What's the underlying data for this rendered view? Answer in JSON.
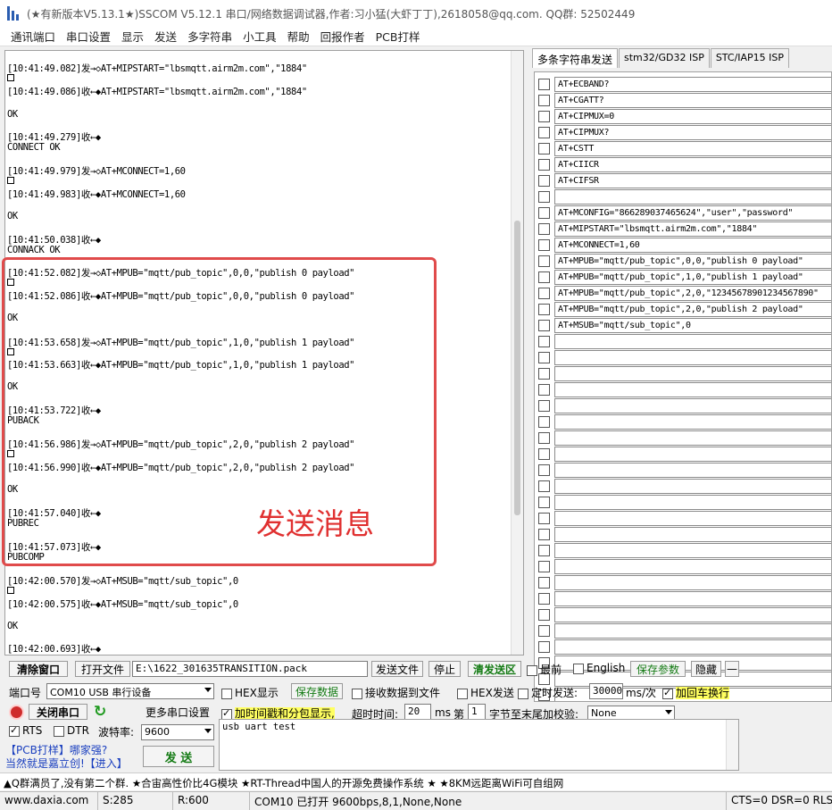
{
  "window": {
    "title": "(★有新版本V5.13.1★)SSCOM V5.12.1 串口/网络数据调试器,作者:习小猛(大虾丁丁),2618058@qq.com. QQ群:  52502449"
  },
  "menu": [
    "通讯端口",
    "串口设置",
    "显示",
    "发送",
    "多字符串",
    "小工具",
    "帮助",
    "回报作者",
    "PCB打样"
  ],
  "log": {
    "lines": [
      "[10:41:49.082]发→◇AT+MIPSTART=\"lbsmqtt.airm2m.com\",\"1884\"",
      "[10:41:49.086]收←◆AT+MIPSTART=\"lbsmqtt.airm2m.com\",\"1884\"",
      "OK",
      "[10:41:49.279]收←◆",
      "CONNECT OK",
      "[10:41:49.979]发→◇AT+MCONNECT=1,60",
      "[10:41:49.983]收←◆AT+MCONNECT=1,60",
      "OK",
      "[10:41:50.038]收←◆",
      "CONNACK OK",
      "[10:41:52.082]发→◇AT+MPUB=\"mqtt/pub_topic\",0,0,\"publish 0 payload\"",
      "[10:41:52.086]收←◆AT+MPUB=\"mqtt/pub_topic\",0,0,\"publish 0 payload\"",
      "OK",
      "[10:41:53.658]发→◇AT+MPUB=\"mqtt/pub_topic\",1,0,\"publish 1 payload\"",
      "[10:41:53.663]收←◆AT+MPUB=\"mqtt/pub_topic\",1,0,\"publish 1 payload\"",
      "OK",
      "[10:41:53.722]收←◆",
      "PUBACK",
      "[10:41:56.986]发→◇AT+MPUB=\"mqtt/pub_topic\",2,0,\"publish 2 payload\"",
      "[10:41:56.990]收←◆AT+MPUB=\"mqtt/pub_topic\",2,0,\"publish 2 payload\"",
      "OK",
      "[10:41:57.040]收←◆",
      "PUBREC",
      "[10:41:57.073]收←◆",
      "PUBCOMP",
      "[10:42:00.570]发→◇AT+MSUB=\"mqtt/sub_topic\",0",
      "[10:42:00.575]收←◆AT+MSUB=\"mqtt/sub_topic\",0",
      "OK",
      "[10:42:00.693]收←◆"
    ],
    "annotation": "发送消息"
  },
  "tabs": [
    "多条字符串发送",
    "stm32/GD32 ISP",
    "STC/IAP15 ISP"
  ],
  "commands": [
    "AT+ECBAND?",
    "AT+CGATT?",
    "AT+CIPMUX=0",
    "AT+CIPMUX?",
    "AT+CSTT",
    "AT+CIICR",
    "AT+CIFSR",
    "",
    "AT+MCONFIG=\"866289037465624\",\"user\",\"password\"",
    "AT+MIPSTART=\"lbsmqtt.airm2m.com\",\"1884\"",
    "AT+MCONNECT=1,60",
    "AT+MPUB=\"mqtt/pub_topic\",0,0,\"publish 0 payload\"",
    "AT+MPUB=\"mqtt/pub_topic\",1,0,\"publish 1 payload\"",
    "AT+MPUB=\"mqtt/pub_topic\",2,0,\"12345678901234567890\"",
    "AT+MPUB=\"mqtt/pub_topic\",2,0,\"publish 2 payload\"",
    "AT+MSUB=\"mqtt/sub_topic\",0",
    "",
    "",
    "",
    "",
    "",
    "",
    "",
    "",
    "",
    "",
    "",
    "",
    "",
    "",
    "",
    "",
    "",
    "",
    "",
    "",
    "",
    "",
    ""
  ],
  "row1": {
    "clear": "清除窗口",
    "open_file": "打开文件",
    "file_path": "E:\\1622_301635TRANSITION.pack",
    "send_file": "发送文件",
    "stop": "停止",
    "clear_send": "清发送区",
    "topmost": "最前",
    "english": "English",
    "save_params": "保存参数",
    "hide": "隐藏",
    "minus": "—"
  },
  "row2": {
    "port_label": "端口号",
    "port_value": "COM10 USB 串行设备",
    "hex_display": "HEX显示",
    "save_data": "保存数据",
    "recv_to_file": "接收数据到文件",
    "hex_send": "HEX发送",
    "timed_send": "定时发送:",
    "interval": "30000",
    "interval_unit": "ms/次",
    "add_crlf": "加回车换行"
  },
  "row3": {
    "close_port": "关闭串口",
    "more_settings": "更多串口设置",
    "timestamp": "加时间戳和分包显示,",
    "timeout_label": "超时时间:",
    "timeout_value": "20",
    "timeout_unit": "ms",
    "byte_label": "第",
    "byte_value": "1",
    "byte_suffix": "字节至末尾加校验:",
    "checksum": "None"
  },
  "row4": {
    "rts": "RTS",
    "dtr": "DTR",
    "baud_label": "波特率:",
    "baud_value": "9600"
  },
  "promo": {
    "line1": "【PCB打样】哪家强?",
    "line2": "当然就是嘉立创!【进入】"
  },
  "send_button": "发 送",
  "send_text": "usb uart test",
  "ticker": "▲Q群满员了,没有第二个群. ★合宙高性价比4G模块 ★RT-Thread中国人的开源免费操作系统 ★ ★8KM远距离WiFi可自组网",
  "status": {
    "site": "www.daxia.com",
    "s": "S:285",
    "r": "R:600",
    "port": "COM10 已打开  9600bps,8,1,None,None",
    "lines": "CTS=0 DSR=0 RLS"
  }
}
